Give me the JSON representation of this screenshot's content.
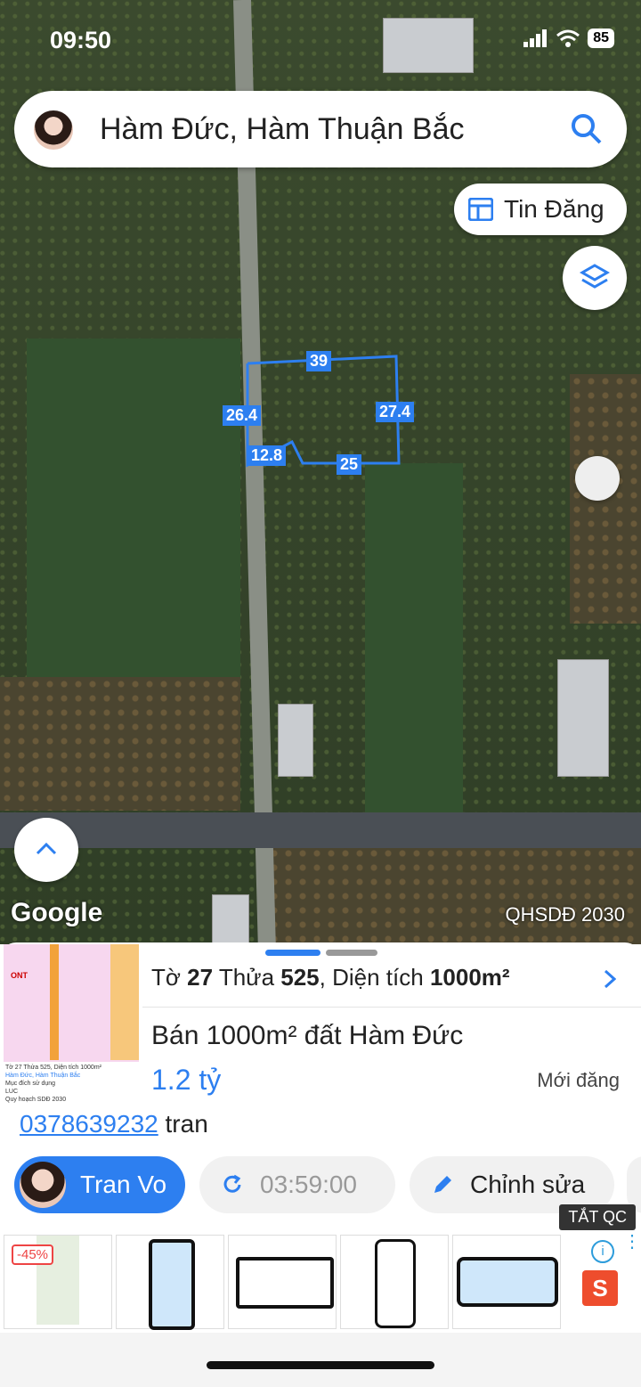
{
  "status": {
    "time": "09:50",
    "battery": "85"
  },
  "search": {
    "text": "Hàm Đức, Hàm Thuận Bắc"
  },
  "map": {
    "tin_dang_label": "Tin Đăng",
    "dimensions": [
      "39",
      "26.4",
      "27.4",
      "12.8",
      "25"
    ],
    "google_label": "Google",
    "plan_label": "QHSDĐ 2030"
  },
  "listing": {
    "thumb_lines": [
      "Tờ 27 Thửa 525, Diện tích 1000m²",
      "Hàm Đức, Hàm Thuận Bắc",
      "Mục đích sử dụng",
      "LUC",
      "Quy hoạch SDĐ 2030"
    ],
    "thumb_label": "ONT",
    "info_prefix_to": "Tờ ",
    "info_to": "27",
    "info_thua_label": " Thửa ",
    "info_thua": "525",
    "info_area_label": ", Diện tích ",
    "info_area": "1000m²",
    "title": "Bán 1000m² đất Hàm Đức",
    "price": "1.2 tỷ",
    "status": "Mới đăng",
    "phone": "0378639232",
    "contact_name": "tran"
  },
  "actions": {
    "user": "Tran Vo",
    "timer": "03:59:00",
    "edit": "Chỉnh sửa",
    "ads_off": "TẮT QC"
  },
  "ads": {
    "discount": "-45%",
    "shop_letter": "S"
  }
}
